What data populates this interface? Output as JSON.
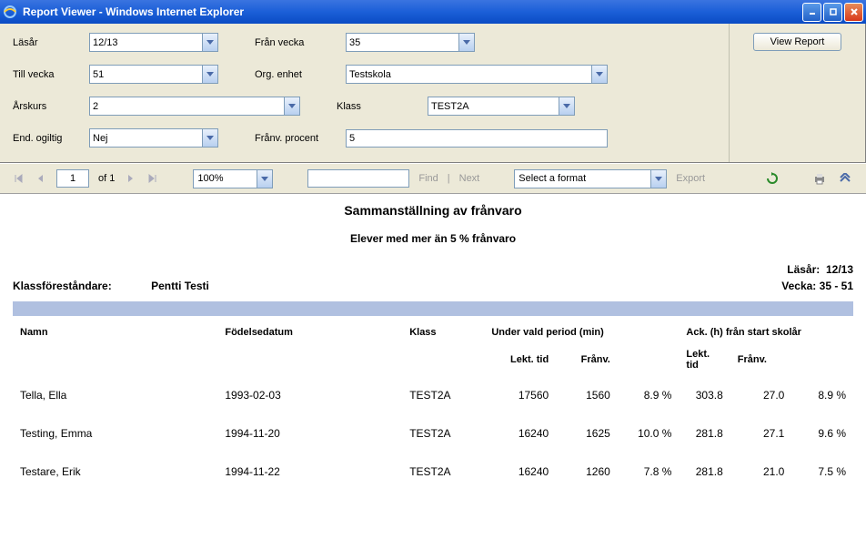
{
  "window": {
    "title": "Report Viewer - Windows Internet Explorer"
  },
  "params": {
    "lasar_label": "Läsår",
    "lasar_value": "12/13",
    "fran_vecka_label": "Från vecka",
    "fran_vecka_value": "35",
    "till_vecka_label": "Till vecka",
    "till_vecka_value": "51",
    "org_enhet_label": "Org. enhet",
    "org_enhet_value": "Testskola",
    "arskurs_label": "Årskurs",
    "arskurs_value": "2",
    "klass_label": "Klass",
    "klass_value": "TEST2A",
    "end_ogiltig_label": "End. ogiltig",
    "end_ogiltig_value": "Nej",
    "franv_procent_label": "Frånv. procent",
    "franv_procent_value": "5",
    "view_report_btn": "View Report"
  },
  "toolbar": {
    "page_current": "1",
    "of_label": "of 1",
    "zoom": "100%",
    "find_label": "Find",
    "next_label": "Next",
    "export_placeholder": "Select a format",
    "export_label": "Export"
  },
  "report": {
    "title": "Sammanställning av frånvaro",
    "subtitle": "Elever med mer än 5 % frånvaro",
    "klassforestandare_label": "Klassföreståndare:",
    "klassforestandare_value": "Pentti Testi",
    "lasar_label": "Läsår:",
    "lasar_value": "12/13",
    "vecka_label": "Vecka:",
    "vecka_value": "35 - 51",
    "headers": {
      "namn": "Namn",
      "fodelsedatum": "Födelsedatum",
      "klass": "Klass",
      "under_period": "Under vald period (min)",
      "ack_start": "Ack. (h) från start skolår",
      "lekt_tid": "Lekt. tid",
      "lekt_tid2": "Lekt. tid",
      "franv": "Frånv.",
      "franv2": "Frånv."
    },
    "rows": [
      {
        "namn": "Tella, Ella",
        "fodelse": "1993-02-03",
        "klass": "TEST2A",
        "p_lekt": "17560",
        "p_franv": "1560",
        "p_pct": "8.9 %",
        "a_lekt": "303.8",
        "a_franv": "27.0",
        "a_pct": "8.9 %"
      },
      {
        "namn": "Testing, Emma",
        "fodelse": "1994-11-20",
        "klass": "TEST2A",
        "p_lekt": "16240",
        "p_franv": "1625",
        "p_pct": "10.0 %",
        "a_lekt": "281.8",
        "a_franv": "27.1",
        "a_pct": "9.6 %"
      },
      {
        "namn": "Testare, Erik",
        "fodelse": "1994-11-22",
        "klass": "TEST2A",
        "p_lekt": "16240",
        "p_franv": "1260",
        "p_pct": "7.8 %",
        "a_lekt": "281.8",
        "a_franv": "21.0",
        "a_pct": "7.5 %"
      }
    ]
  }
}
